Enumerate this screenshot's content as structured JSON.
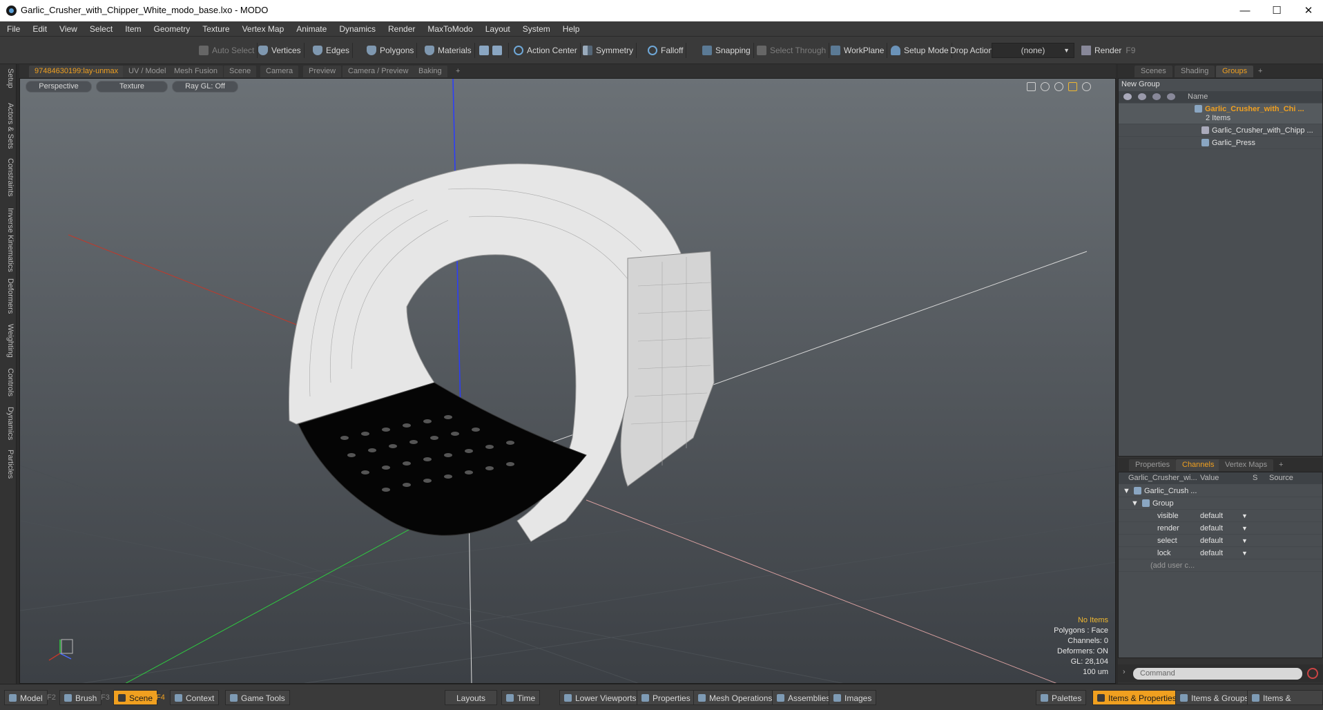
{
  "window": {
    "title": "Garlic_Crusher_with_Chipper_White_modo_base.lxo - MODO",
    "minimize": "—",
    "maximize": "☐",
    "close": "✕"
  },
  "menu": [
    "File",
    "Edit",
    "View",
    "Select",
    "Item",
    "Geometry",
    "Texture",
    "Vertex Map",
    "Animate",
    "Dynamics",
    "Render",
    "MaxToModo",
    "Layout",
    "System",
    "Help"
  ],
  "toolbar": {
    "auto_select": "Auto Select",
    "vertices": "Vertices",
    "edges": "Edges",
    "polygons": "Polygons",
    "materials": "Materials",
    "action_center": "Action Center",
    "symmetry": "Symmetry",
    "falloff": "Falloff",
    "snapping": "Snapping",
    "select_through": "Select Through",
    "workplane": "WorkPlane",
    "setup_mode": "Setup Mode",
    "drop_action_label": "Drop Action",
    "drop_action_value": "(none)",
    "render": "Render",
    "render_key": "F9"
  },
  "left_tabs": [
    "Setup",
    "Actors & Sets",
    "Constraints",
    "Inverse Kinematics",
    "Deformers",
    "Weighting",
    "Controls",
    "Dynamics",
    "Particles"
  ],
  "viewport_tabs": [
    "97484630199:lay-unmax",
    "UV / Model",
    "Mesh Fusion",
    "Scene",
    "Camera",
    "Preview",
    "Camera / Preview",
    "Baking",
    "+"
  ],
  "viewport": {
    "view_mode": "Perspective",
    "shading": "Texture",
    "raygl": "Ray GL: Off",
    "info": {
      "items": "No Items",
      "polygons": "Polygons : Face",
      "channels": "Channels: 0",
      "deformers": "Deformers: ON",
      "gl": "GL: 28,104",
      "scale": "100 um"
    }
  },
  "groups_panel": {
    "tabs": [
      "Scenes",
      "Shading",
      "Groups",
      "+"
    ],
    "new_group": "New Group",
    "name_header": "Name",
    "root_name": "Garlic_Crusher_with_Chi ...",
    "root_count": "2 Items",
    "children": [
      "Garlic_Crusher_with_Chipp ...",
      "Garlic_Press"
    ]
  },
  "channels_panel": {
    "tabs": [
      "Properties",
      "Channels",
      "Vertex Maps",
      "+"
    ],
    "headers": {
      "name": "Garlic_Crusher_wi...",
      "value": "Value",
      "s": "S",
      "source": "Source"
    },
    "root": "Garlic_Crush ...",
    "group": "Group",
    "rows": [
      {
        "name": "visible",
        "value": "default"
      },
      {
        "name": "render",
        "value": "default"
      },
      {
        "name": "select",
        "value": "default"
      },
      {
        "name": "lock",
        "value": "default"
      }
    ],
    "add_user": "(add user c..."
  },
  "command": {
    "placeholder": "Command"
  },
  "bottom": {
    "model": "Model",
    "model_key": "F2",
    "brush": "Brush",
    "brush_key": "F3",
    "scene": "Scene",
    "scene_key": "F4",
    "context": "Context",
    "game_tools": "Game Tools",
    "layouts": "Layouts",
    "time": "Time",
    "lower_viewports": "Lower Viewports",
    "properties": "Properties",
    "mesh_operations": "Mesh Operations",
    "assemblies": "Assemblies",
    "images": "Images",
    "palettes": "Palettes",
    "items_properties": "Items & Properties",
    "items_groups": "Items & Groups",
    "items_shading": "Items & Shading"
  },
  "colors": {
    "accent": "#f0a020",
    "panel": "#3a3a3a",
    "viewport_top": "#6b7176"
  }
}
